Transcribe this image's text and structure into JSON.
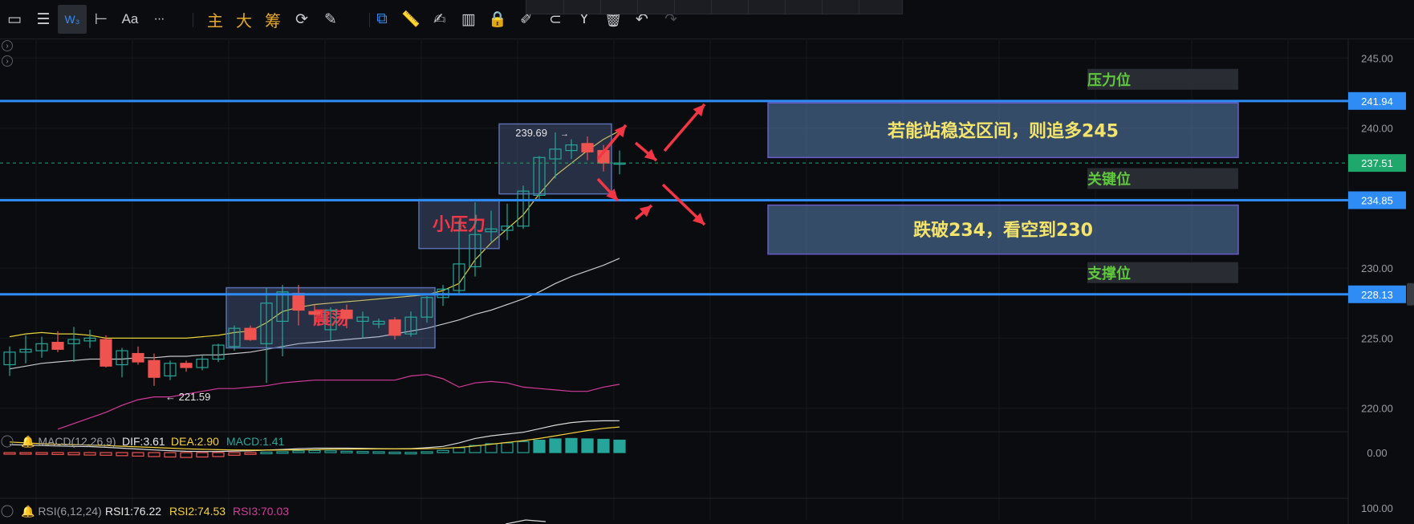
{
  "toolbar": {
    "tools": [
      {
        "name": "rectangle-icon",
        "glyph": "▭"
      },
      {
        "name": "menu-icon",
        "glyph": "☰"
      },
      {
        "name": "wave-icon",
        "glyph": "W₃",
        "active": true
      },
      {
        "name": "horizontal-ray-icon",
        "glyph": "⊢"
      },
      {
        "name": "text-icon",
        "glyph": "Aa"
      },
      {
        "name": "more-icon",
        "glyph": "···"
      },
      {
        "name": "main-icon",
        "glyph": "主",
        "gold": true
      },
      {
        "name": "big-icon",
        "glyph": "大",
        "gold": true
      },
      {
        "name": "chip-icon",
        "glyph": "筹",
        "gold": true
      },
      {
        "name": "refresh-icon",
        "glyph": "⟳"
      },
      {
        "name": "crosshair-icon",
        "glyph": "✎"
      },
      {
        "name": "copy-icon",
        "glyph": "⧉",
        "blue": true
      },
      {
        "name": "ruler-icon",
        "glyph": "📏"
      },
      {
        "name": "pen-icon",
        "glyph": "✍"
      },
      {
        "name": "candles-icon",
        "glyph": "▥"
      },
      {
        "name": "lock-icon",
        "glyph": "🔒"
      },
      {
        "name": "edit-icon",
        "glyph": "✐"
      },
      {
        "name": "magnet-icon",
        "glyph": "⊂"
      },
      {
        "name": "filter-icon",
        "glyph": "Y"
      },
      {
        "name": "trash-icon",
        "glyph": "🗑"
      },
      {
        "name": "undo-icon",
        "glyph": "↶"
      },
      {
        "name": "redo-icon",
        "glyph": "↷",
        "dim": true
      }
    ]
  },
  "colors": {
    "background": "#0b0c0f",
    "up": "#26a69a",
    "down": "#ef5350",
    "level_line": "#2f8cf5",
    "level_label": "#5dc93b",
    "annotation_red": "#f23645",
    "annotation_yellow": "#f5e46b",
    "zone_box": "#5a6fb0",
    "last_price": "#1fa86b"
  },
  "chart_data": {
    "type": "candlestick",
    "yaxis": {
      "ticks": [
        "245.00",
        "240.00",
        "235.00",
        "230.00",
        "225.00",
        "220.00"
      ],
      "tick_values": [
        245,
        240,
        235,
        230,
        225,
        220
      ],
      "ylim": [
        218.2,
        246.4
      ]
    },
    "candles": [
      {
        "o": 223.1,
        "h": 224.4,
        "l": 222.3,
        "c": 224.0
      },
      {
        "o": 224.0,
        "h": 225.2,
        "l": 223.2,
        "c": 224.2
      },
      {
        "o": 224.1,
        "h": 225.1,
        "l": 223.6,
        "c": 224.6
      },
      {
        "o": 224.7,
        "h": 225.5,
        "l": 224.0,
        "c": 224.2
      },
      {
        "o": 224.6,
        "h": 225.8,
        "l": 223.3,
        "c": 224.9
      },
      {
        "o": 224.8,
        "h": 225.6,
        "l": 224.3,
        "c": 225.0
      },
      {
        "o": 224.9,
        "h": 225.2,
        "l": 222.9,
        "c": 223.0
      },
      {
        "o": 223.1,
        "h": 224.3,
        "l": 222.2,
        "c": 224.1
      },
      {
        "o": 223.9,
        "h": 224.4,
        "l": 223.1,
        "c": 223.3
      },
      {
        "o": 223.4,
        "h": 223.9,
        "l": 221.59,
        "c": 222.2
      },
      {
        "o": 222.3,
        "h": 223.4,
        "l": 222.0,
        "c": 223.2
      },
      {
        "o": 223.2,
        "h": 223.4,
        "l": 222.6,
        "c": 222.9
      },
      {
        "o": 222.9,
        "h": 223.8,
        "l": 222.7,
        "c": 223.5
      },
      {
        "o": 223.5,
        "h": 224.6,
        "l": 223.3,
        "c": 224.5
      },
      {
        "o": 224.4,
        "h": 225.9,
        "l": 224.1,
        "c": 225.7
      },
      {
        "o": 225.7,
        "h": 225.9,
        "l": 224.8,
        "c": 224.9
      },
      {
        "o": 224.6,
        "h": 228.6,
        "l": 221.8,
        "c": 227.5
      },
      {
        "o": 226.2,
        "h": 228.8,
        "l": 223.7,
        "c": 228.3
      },
      {
        "o": 228.2,
        "h": 228.8,
        "l": 225.9,
        "c": 227.0
      },
      {
        "o": 226.9,
        "h": 227.4,
        "l": 226.0,
        "c": 226.7
      },
      {
        "o": 225.6,
        "h": 227.2,
        "l": 224.8,
        "c": 227.0
      },
      {
        "o": 227.0,
        "h": 227.4,
        "l": 225.7,
        "c": 226.4
      },
      {
        "o": 226.2,
        "h": 226.9,
        "l": 225.0,
        "c": 226.5
      },
      {
        "o": 226.0,
        "h": 226.4,
        "l": 225.7,
        "c": 226.2
      },
      {
        "o": 226.3,
        "h": 226.5,
        "l": 224.9,
        "c": 225.2
      },
      {
        "o": 225.3,
        "h": 226.9,
        "l": 225.1,
        "c": 226.5
      },
      {
        "o": 226.5,
        "h": 228.0,
        "l": 226.1,
        "c": 227.9
      },
      {
        "o": 227.9,
        "h": 228.8,
        "l": 227.3,
        "c": 228.5
      },
      {
        "o": 228.4,
        "h": 233.4,
        "l": 228.1,
        "c": 230.3
      },
      {
        "o": 230.1,
        "h": 234.7,
        "l": 229.4,
        "c": 232.4
      },
      {
        "o": 232.6,
        "h": 234.1,
        "l": 231.9,
        "c": 232.8
      },
      {
        "o": 232.7,
        "h": 234.6,
        "l": 232.0,
        "c": 233.0
      },
      {
        "o": 233.0,
        "h": 235.9,
        "l": 232.8,
        "c": 235.5
      },
      {
        "o": 235.2,
        "h": 238.0,
        "l": 234.9,
        "c": 237.9
      },
      {
        "o": 237.8,
        "h": 239.69,
        "l": 236.4,
        "c": 238.5
      },
      {
        "o": 238.4,
        "h": 239.2,
        "l": 237.8,
        "c": 238.8
      },
      {
        "o": 238.9,
        "h": 239.4,
        "l": 237.7,
        "c": 238.3
      },
      {
        "o": 238.4,
        "h": 238.8,
        "l": 236.9,
        "c": 237.5
      },
      {
        "o": 237.5,
        "h": 238.4,
        "l": 236.7,
        "c": 237.51
      }
    ],
    "moving_averages": [
      {
        "name": "upper-band",
        "color": "#e6d23a",
        "values": [
          225.1,
          225.3,
          225.4,
          225.3,
          225.3,
          225.2,
          225.0,
          225.0,
          225.0,
          225.0,
          225.0,
          225.0,
          225.1,
          225.2,
          225.4,
          225.5,
          226.1,
          226.9,
          227.2,
          227.4,
          227.5,
          227.6,
          227.7,
          227.8,
          227.9,
          228.0,
          228.1,
          228.4,
          228.9,
          230.6,
          231.8,
          232.8,
          233.8,
          235.3,
          236.6,
          237.5,
          238.4,
          239.2,
          239.8
        ]
      },
      {
        "name": "middle-band",
        "color": "#c8c8cc",
        "values": [
          222.8,
          223.0,
          223.2,
          223.3,
          223.4,
          223.5,
          223.5,
          223.5,
          223.6,
          223.6,
          223.7,
          223.7,
          223.8,
          223.8,
          223.9,
          224.0,
          224.2,
          224.4,
          224.6,
          224.7,
          224.8,
          224.9,
          225.0,
          225.1,
          225.3,
          225.5,
          225.7,
          226.0,
          226.3,
          226.7,
          227.0,
          227.4,
          227.8,
          228.3,
          228.9,
          229.4,
          229.8,
          230.2,
          230.7
        ]
      },
      {
        "name": "lower-band",
        "color": "#d43a9a",
        "values": [
          null,
          null,
          null,
          218.5,
          218.9,
          219.3,
          219.7,
          220.2,
          220.6,
          220.8,
          220.8,
          221.0,
          221.2,
          221.4,
          221.4,
          221.5,
          221.6,
          221.8,
          221.9,
          222.0,
          222.0,
          222.0,
          222.0,
          222.0,
          222.0,
          222.3,
          222.4,
          222.1,
          221.5,
          221.8,
          221.9,
          221.8,
          221.5,
          221.4,
          221.3,
          221.2,
          221.2,
          221.5,
          221.7
        ]
      }
    ],
    "price_labels": [
      {
        "text": "239.69",
        "value": 239.69,
        "candle": 34,
        "side": "left",
        "arrow": "→"
      },
      {
        "text": "221.59",
        "value": 221.59,
        "candle": 9,
        "side": "right",
        "arrow": "←"
      }
    ],
    "levels": [
      {
        "value": 241.94,
        "label": "241.94",
        "color": "#2f8cf5",
        "tag": "压力位"
      },
      {
        "value": 234.85,
        "label": "234.85",
        "color": "#2f8cf5",
        "tag": "关键位"
      },
      {
        "value": 228.13,
        "label": "228.13",
        "color": "#2f8cf5",
        "tag": "支撑位"
      }
    ],
    "last_price": {
      "value": 237.51,
      "label": "237.51",
      "color": "#1fa86b"
    },
    "zones": [
      {
        "label": "震荡",
        "from_candle": 14,
        "to_candle": 26,
        "top": 228.6,
        "bottom": 224.3
      },
      {
        "label": "小压力",
        "from_candle": 26,
        "to_candle": 30,
        "top": 234.9,
        "bottom": 231.4
      },
      {
        "label": "",
        "from_candle": 31,
        "to_candle": 37,
        "top": 240.3,
        "bottom": 235.3
      }
    ],
    "notes": [
      {
        "text": "若能站稳这区间，则追多245",
        "top": 241.8,
        "bottom": 237.9
      },
      {
        "text": "跌破234，看空到230",
        "top": 234.5,
        "bottom": 231.0
      }
    ],
    "macd": {
      "label": "MACD(12,26,9)",
      "dif_label": "DIF:3.61",
      "dea_label": "DEA:2.90",
      "macd_label": "MACD:1.41",
      "zero_tick": "0.00",
      "dif": [
        0.9,
        0.85,
        0.8,
        0.75,
        0.7,
        0.68,
        0.6,
        0.5,
        0.4,
        0.3,
        0.22,
        0.15,
        0.12,
        0.13,
        0.17,
        0.2,
        0.28,
        0.35,
        0.45,
        0.5,
        0.5,
        0.5,
        0.48,
        0.45,
        0.42,
        0.45,
        0.55,
        0.7,
        1.1,
        1.6,
        1.9,
        2.1,
        2.3,
        2.7,
        3.1,
        3.4,
        3.55,
        3.6,
        3.61
      ],
      "dea": [
        1.2,
        1.1,
        1.0,
        0.95,
        0.9,
        0.85,
        0.8,
        0.72,
        0.65,
        0.58,
        0.5,
        0.43,
        0.37,
        0.33,
        0.3,
        0.28,
        0.28,
        0.29,
        0.31,
        0.34,
        0.37,
        0.39,
        0.41,
        0.42,
        0.42,
        0.42,
        0.44,
        0.48,
        0.58,
        0.75,
        0.95,
        1.15,
        1.35,
        1.6,
        1.9,
        2.2,
        2.5,
        2.75,
        2.9
      ],
      "hist": [
        -0.18,
        -0.18,
        -0.2,
        -0.22,
        -0.25,
        -0.28,
        -0.3,
        -0.35,
        -0.4,
        -0.45,
        -0.5,
        -0.55,
        -0.5,
        -0.45,
        -0.3,
        -0.2,
        0.05,
        0.1,
        0.2,
        0.25,
        0.2,
        0.15,
        0.12,
        0.1,
        0.05,
        0.03,
        0.1,
        0.25,
        0.55,
        0.8,
        1.0,
        1.1,
        1.25,
        1.4,
        1.55,
        1.6,
        1.55,
        1.5,
        1.41
      ]
    },
    "rsi": {
      "label": "RSI(6,12,24)",
      "rsi1_label": "RSI1:76.22",
      "rsi2_label": "RSI2:74.53",
      "rsi3_label": "RSI3:70.03",
      "tick": "100.00"
    }
  }
}
